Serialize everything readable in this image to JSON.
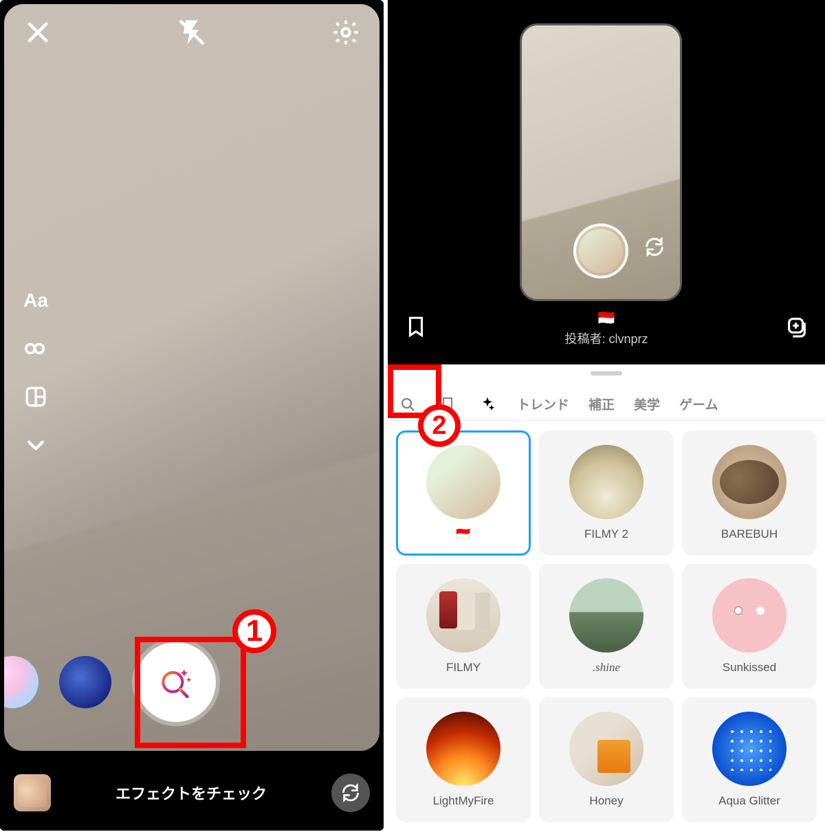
{
  "left": {
    "bottom_text": "エフェクトをチェック",
    "text_tool_label": "Aa"
  },
  "annotation": {
    "badge1": "1",
    "badge2": "2"
  },
  "right": {
    "effect_flag": "🇮🇩",
    "posted_by": "投稿者: clvnprz",
    "tabs": {
      "trend": "トレンド",
      "correction": "補正",
      "aesthetic": "美学",
      "game": "ゲーム"
    },
    "effects": [
      {
        "label": "🇮🇩"
      },
      {
        "label": "FILMY 2"
      },
      {
        "label": "BAREBUH"
      },
      {
        "label": "FILMY"
      },
      {
        "label": ".shine"
      },
      {
        "label": "Sunkissed"
      },
      {
        "label": "LightMyFire"
      },
      {
        "label": "Honey"
      },
      {
        "label": "Aqua Glitter"
      }
    ]
  }
}
